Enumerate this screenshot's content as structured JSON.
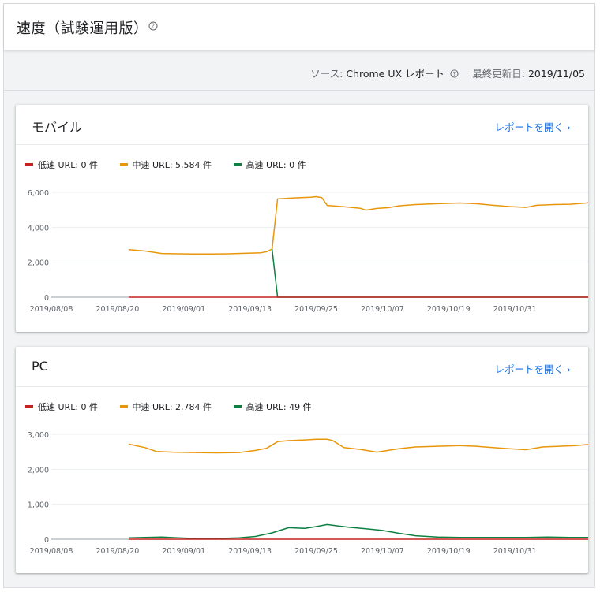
{
  "header": {
    "title": "速度（試験運用版）",
    "help_icon": "help-circle-icon"
  },
  "subbar": {
    "source_label": "ソース: ",
    "source_value": "Chrome UX レポート",
    "updated_label": "最終更新日: ",
    "updated_value": "2019/11/05"
  },
  "colors": {
    "slow": "#c5221f",
    "medium": "#e8960c",
    "fast": "#0d7f3f",
    "link": "#1a73e8"
  },
  "cards": [
    {
      "title": "モバイル",
      "link_label": "レポートを開く",
      "legend": {
        "slow": "低速 URL: 0 件",
        "medium": "中速 URL: 5,584 件",
        "fast": "高速 URL: 0 件"
      }
    },
    {
      "title": "PC",
      "link_label": "レポートを開く",
      "legend": {
        "slow": "低速 URL: 0 件",
        "medium": "中速 URL: 2,784 件",
        "fast": "高速 URL: 49 件"
      }
    }
  ],
  "chart_data": [
    {
      "type": "line",
      "x_labels": [
        "2019/08/08",
        "2019/08/20",
        "2019/09/01",
        "2019/09/13",
        "2019/09/25",
        "2019/10/07",
        "2019/10/19",
        "2019/10/31"
      ],
      "ylim": [
        0,
        6000
      ],
      "y_ticks": [
        "0",
        "2,000",
        "4,000",
        "6,000"
      ],
      "grid": true,
      "legend_position": "top-left",
      "series": [
        {
          "name": "中速 URL",
          "key": "medium",
          "points": [
            [
              14,
              2720
            ],
            [
              17,
              2640
            ],
            [
              20,
              2500
            ],
            [
              23,
              2480
            ],
            [
              26,
              2470
            ],
            [
              29,
              2470
            ],
            [
              32,
              2480
            ],
            [
              35,
              2510
            ],
            [
              38,
              2540
            ],
            [
              39,
              2600
            ],
            [
              40,
              2750
            ],
            [
              41,
              5620
            ],
            [
              44,
              5680
            ],
            [
              47,
              5720
            ],
            [
              48,
              5750
            ],
            [
              49,
              5700
            ],
            [
              50,
              5250
            ],
            [
              53,
              5180
            ],
            [
              56,
              5090
            ],
            [
              57,
              4980
            ],
            [
              59,
              5080
            ],
            [
              61,
              5120
            ],
            [
              63,
              5230
            ],
            [
              66,
              5300
            ],
            [
              70,
              5350
            ],
            [
              74,
              5390
            ],
            [
              77,
              5350
            ],
            [
              80,
              5260
            ],
            [
              83,
              5190
            ],
            [
              86,
              5140
            ],
            [
              88,
              5260
            ],
            [
              91,
              5300
            ],
            [
              94,
              5320
            ],
            [
              97,
              5390
            ],
            [
              99,
              5500
            ],
            [
              102,
              5530
            ],
            [
              105,
              5560
            ],
            [
              107,
              5584
            ]
          ]
        },
        {
          "name": "高速 URL",
          "key": "fast",
          "points": [
            [
              40,
              2750
            ],
            [
              41,
              0
            ],
            [
              107,
              0
            ]
          ]
        },
        {
          "name": "低速 URL",
          "key": "slow",
          "points": [
            [
              14,
              0
            ],
            [
              107,
              0
            ]
          ]
        }
      ]
    },
    {
      "type": "line",
      "x_labels": [
        "2019/08/08",
        "2019/08/20",
        "2019/09/01",
        "2019/09/13",
        "2019/09/25",
        "2019/10/07",
        "2019/10/19",
        "2019/10/31"
      ],
      "ylim": [
        0,
        3000
      ],
      "y_ticks": [
        "0",
        "1,000",
        "2,000",
        "3,000"
      ],
      "grid": true,
      "legend_position": "top-left",
      "series": [
        {
          "name": "中速 URL",
          "key": "medium",
          "points": [
            [
              14,
              2720
            ],
            [
              17,
              2620
            ],
            [
              19,
              2510
            ],
            [
              22,
              2490
            ],
            [
              26,
              2480
            ],
            [
              30,
              2470
            ],
            [
              34,
              2480
            ],
            [
              37,
              2540
            ],
            [
              39,
              2600
            ],
            [
              41,
              2790
            ],
            [
              43,
              2820
            ],
            [
              46,
              2840
            ],
            [
              48,
              2860
            ],
            [
              50,
              2860
            ],
            [
              51,
              2820
            ],
            [
              53,
              2620
            ],
            [
              56,
              2570
            ],
            [
              59,
              2490
            ],
            [
              61,
              2540
            ],
            [
              63,
              2590
            ],
            [
              66,
              2640
            ],
            [
              70,
              2660
            ],
            [
              74,
              2680
            ],
            [
              77,
              2660
            ],
            [
              80,
              2620
            ],
            [
              83,
              2590
            ],
            [
              86,
              2560
            ],
            [
              89,
              2640
            ],
            [
              92,
              2660
            ],
            [
              95,
              2680
            ],
            [
              98,
              2720
            ],
            [
              101,
              2750
            ],
            [
              104,
              2770
            ],
            [
              107,
              2784
            ]
          ]
        },
        {
          "name": "高速 URL",
          "key": "fast",
          "points": [
            [
              14,
              40
            ],
            [
              17,
              50
            ],
            [
              20,
              60
            ],
            [
              23,
              40
            ],
            [
              26,
              20
            ],
            [
              30,
              20
            ],
            [
              34,
              40
            ],
            [
              37,
              80
            ],
            [
              40,
              180
            ],
            [
              43,
              330
            ],
            [
              46,
              310
            ],
            [
              48,
              360
            ],
            [
              50,
              420
            ],
            [
              52,
              380
            ],
            [
              54,
              340
            ],
            [
              57,
              300
            ],
            [
              60,
              250
            ],
            [
              63,
              170
            ],
            [
              66,
              100
            ],
            [
              70,
              60
            ],
            [
              74,
              50
            ],
            [
              80,
              50
            ],
            [
              86,
              50
            ],
            [
              90,
              60
            ],
            [
              94,
              50
            ],
            [
              100,
              50
            ],
            [
              104,
              50
            ],
            [
              107,
              49
            ]
          ]
        },
        {
          "name": "低速 URL",
          "key": "slow",
          "points": [
            [
              14,
              0
            ],
            [
              107,
              0
            ]
          ]
        }
      ]
    }
  ]
}
